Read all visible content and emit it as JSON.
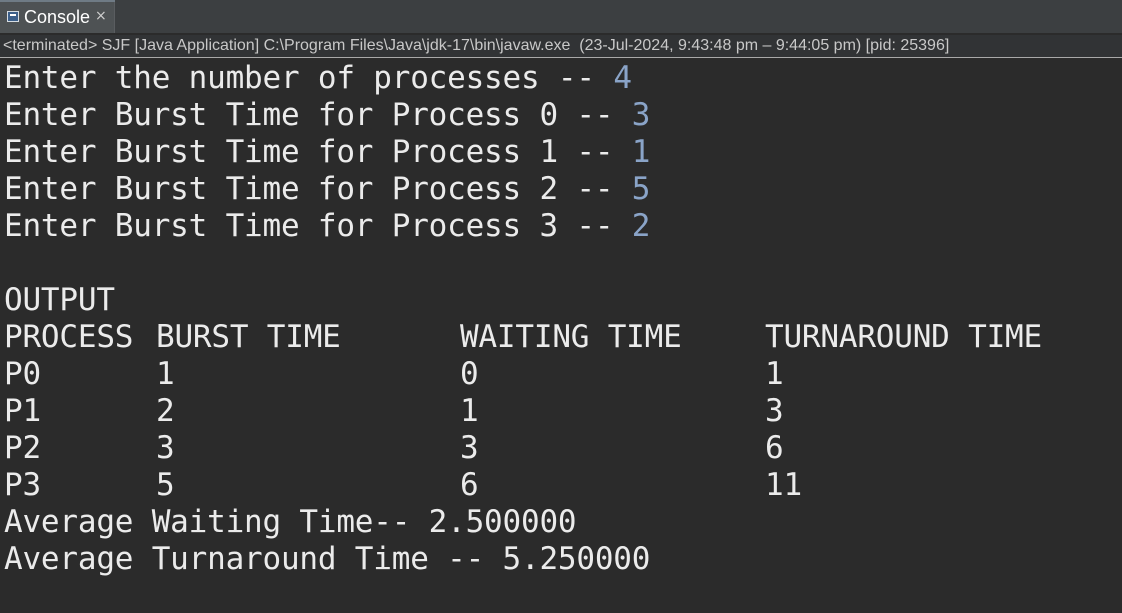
{
  "tab": {
    "label": "Console",
    "close": "×"
  },
  "status": "<terminated> SJF [Java Application] C:\\Program Files\\Java\\jdk-17\\bin\\javaw.exe  (23-Jul-2024, 9:43:48 pm – 9:44:05 pm) [pid: 25396]",
  "prompts": [
    {
      "text": "Enter the number of processes -- ",
      "input": "4"
    },
    {
      "text": "Enter Burst Time for Process 0 -- ",
      "input": "3"
    },
    {
      "text": "Enter Burst Time for Process 1 -- ",
      "input": "1"
    },
    {
      "text": "Enter Burst Time for Process 2 -- ",
      "input": "5"
    },
    {
      "text": "Enter Burst Time for Process 3 -- ",
      "input": "2"
    }
  ],
  "output_label": "OUTPUT",
  "table": {
    "headers": [
      "PROCESS",
      "BURST TIME",
      "WAITING TIME",
      "TURNAROUND TIME"
    ],
    "rows": [
      [
        "P0",
        "1",
        "0",
        "1"
      ],
      [
        "P1",
        "2",
        "1",
        "3"
      ],
      [
        "P2",
        "3",
        "3",
        "6"
      ],
      [
        "P3",
        "5",
        "6",
        "11"
      ]
    ]
  },
  "avg_waiting": "Average Waiting Time-- 2.500000",
  "avg_turnaround": "Average Turnaround Time -- 5.250000",
  "colors": {
    "background": "#2b2b2b",
    "text": "#ebebeb",
    "input": "#8aa4c8"
  }
}
